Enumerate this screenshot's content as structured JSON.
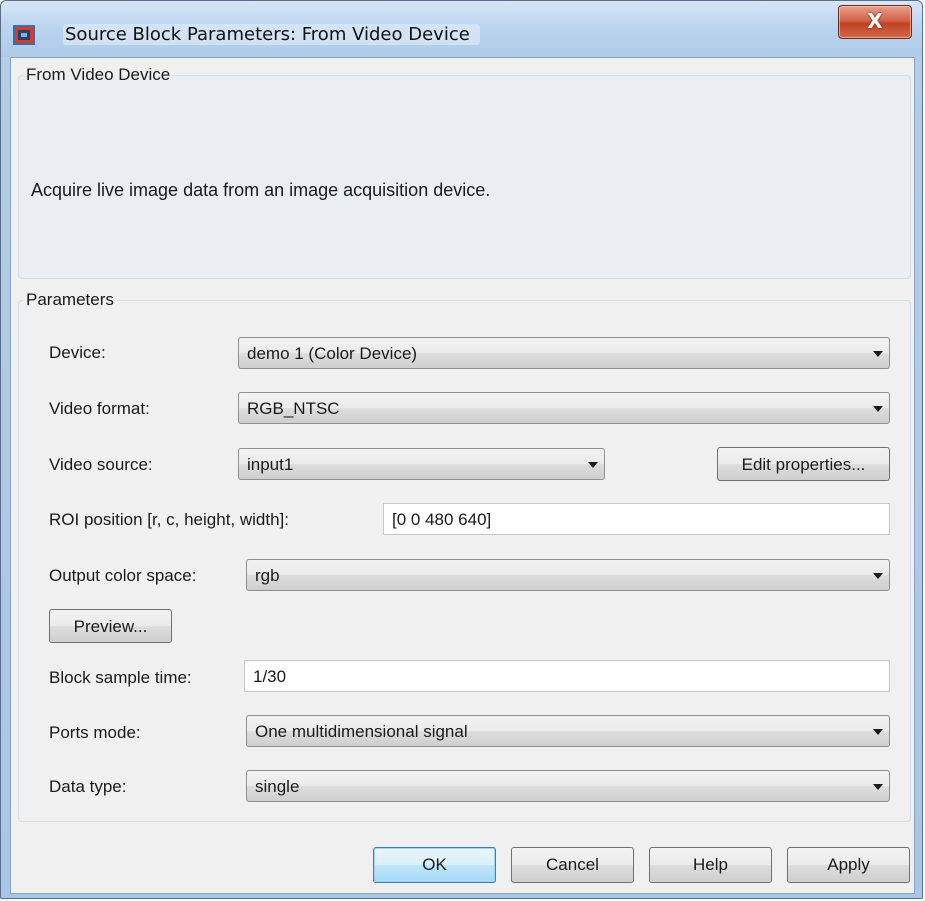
{
  "window": {
    "title": "Source Block Parameters: From Video Device",
    "close_label": "X"
  },
  "description": {
    "group_title": "From Video Device",
    "text": "Acquire live image data from an image acquisition device."
  },
  "parameters": {
    "group_title": "Parameters",
    "device": {
      "label": "Device:",
      "value": "demo 1 (Color Device)"
    },
    "video_format": {
      "label": "Video format:",
      "value": "RGB_NTSC"
    },
    "video_source": {
      "label": "Video source:",
      "value": "input1"
    },
    "edit_properties_label": "Edit properties...",
    "roi_position": {
      "label": "ROI position [r, c, height, width]:",
      "value": "[0 0 480 640]"
    },
    "output_color_space": {
      "label": "Output color space:",
      "value": "rgb"
    },
    "preview_label": "Preview...",
    "block_sample_time": {
      "label": "Block sample time:",
      "value": "1/30"
    },
    "ports_mode": {
      "label": "Ports mode:",
      "value": "One multidimensional signal"
    },
    "data_type": {
      "label": "Data type:",
      "value": "single"
    }
  },
  "buttons": {
    "ok": "OK",
    "cancel": "Cancel",
    "help": "Help",
    "apply": "Apply"
  },
  "icons": {
    "app_icon": "simulink-block-icon",
    "close_icon": "close-icon",
    "dropdown_icon": "chevron-down-icon"
  },
  "colors": {
    "titlebar": "#bcd4ee",
    "close_button": "#c24322",
    "client_background": "#f0f0f0",
    "default_button": "#bee6fd"
  }
}
